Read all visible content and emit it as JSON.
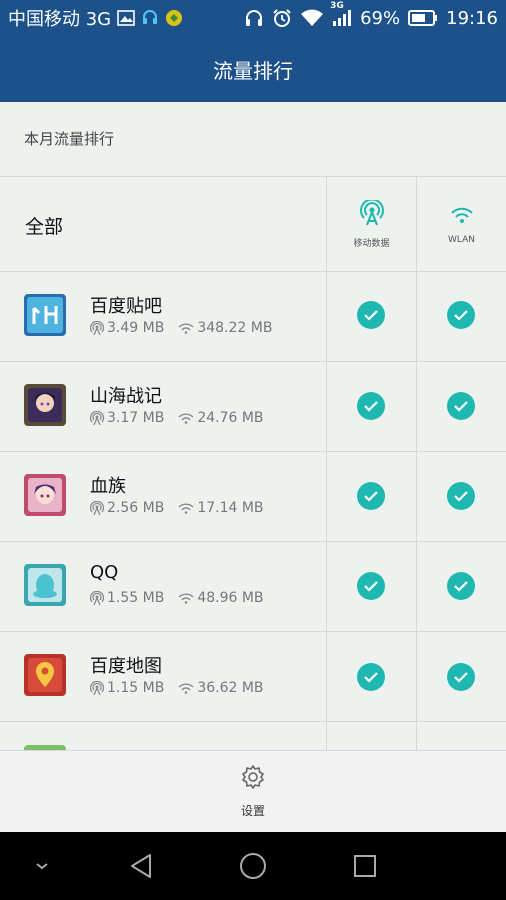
{
  "status_bar": {
    "carrier": "中国移动 3G",
    "network_label": "3G",
    "battery": "69%",
    "time": "19:16"
  },
  "title": "流量排行",
  "caption": "本月流量排行",
  "header": {
    "all_label": "全部",
    "mobile_label": "移动数据",
    "wlan_label": "WLAN"
  },
  "apps": [
    {
      "name": "百度贴吧",
      "mobile": "3.49 MB",
      "wifi": "348.22 MB",
      "mobile_enabled": true,
      "wlan_enabled": true
    },
    {
      "name": "山海战记",
      "mobile": "3.17 MB",
      "wifi": "24.76 MB",
      "mobile_enabled": true,
      "wlan_enabled": true
    },
    {
      "name": "血族",
      "mobile": "2.56 MB",
      "wifi": "17.14 MB",
      "mobile_enabled": true,
      "wlan_enabled": true
    },
    {
      "name": "QQ",
      "mobile": "1.55 MB",
      "wifi": "48.96 MB",
      "mobile_enabled": true,
      "wlan_enabled": true
    },
    {
      "name": "百度地图",
      "mobile": "1.15 MB",
      "wifi": "36.62 MB",
      "mobile_enabled": true,
      "wlan_enabled": true
    }
  ],
  "settings_label": "设置",
  "colors": {
    "header": "#1c5289",
    "check": "#1fb8b0",
    "background": "#eef2ee"
  },
  "icons": {
    "mobile_data": "antenna-icon",
    "wlan": "wifi-icon",
    "settings": "gear-icon"
  }
}
